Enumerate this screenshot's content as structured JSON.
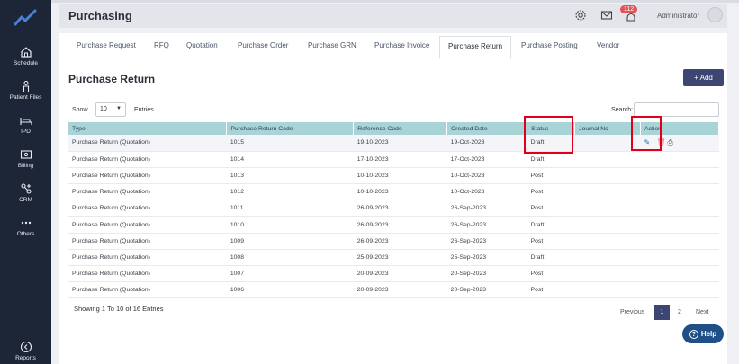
{
  "sidebar": {
    "items": [
      {
        "label": "Schedule",
        "icon": "home-icon"
      },
      {
        "label": "Patient Files",
        "icon": "person-icon"
      },
      {
        "label": "IPD",
        "icon": "bed-icon"
      },
      {
        "label": "Billing",
        "icon": "billing-icon"
      },
      {
        "label": "CRM",
        "icon": "crm-icon"
      },
      {
        "label": "Others",
        "icon": "more-icon"
      },
      {
        "label": "Reports",
        "icon": "reports-icon"
      }
    ]
  },
  "header": {
    "title": "Purchasing",
    "notification_count": "112",
    "user": "Administrator"
  },
  "tabs": [
    "Purchase Request",
    "RFQ",
    "Quotation",
    "Purchase Order",
    "Purchase GRN",
    "Purchase Invoice",
    "Purchase Return",
    "Purchase Posting",
    "Vendor"
  ],
  "active_tab": "Purchase Return",
  "page": {
    "title": "Purchase Return",
    "add_label": "+ Add"
  },
  "controls": {
    "show_label": "Show",
    "entries_value": "10",
    "entries_label": "Entries",
    "search_label": "Search:"
  },
  "table": {
    "columns": [
      "Type",
      "Purchase Return Code",
      "Reference Code",
      "Created Date",
      "Status",
      "Journal No",
      "Action"
    ],
    "rows": [
      {
        "type": "Purchase Return (Quotation)",
        "code": "1015",
        "ref": "19-10-2023",
        "created": "19-Oct-2023",
        "status": "Draft",
        "journal": ""
      },
      {
        "type": "Purchase Return (Quotation)",
        "code": "1014",
        "ref": "17-10-2023",
        "created": "17-Oct-2023",
        "status": "Draft",
        "journal": ""
      },
      {
        "type": "Purchase Return (Quotation)",
        "code": "1013",
        "ref": "10-10-2023",
        "created": "10-Oct-2023",
        "status": "Post",
        "journal": ""
      },
      {
        "type": "Purchase Return (Quotation)",
        "code": "1012",
        "ref": "10-10-2023",
        "created": "10-Oct-2023",
        "status": "Post",
        "journal": ""
      },
      {
        "type": "Purchase Return (Quotation)",
        "code": "1011",
        "ref": "26-09-2023",
        "created": "26-Sep-2023",
        "status": "Post",
        "journal": ""
      },
      {
        "type": "Purchase Return (Quotation)",
        "code": "1010",
        "ref": "26-09-2023",
        "created": "26-Sep-2023",
        "status": "Draft",
        "journal": ""
      },
      {
        "type": "Purchase Return (Quotation)",
        "code": "1009",
        "ref": "26-09-2023",
        "created": "26-Sep-2023",
        "status": "Post",
        "journal": ""
      },
      {
        "type": "Purchase Return (Quotation)",
        "code": "1008",
        "ref": "25-09-2023",
        "created": "25-Sep-2023",
        "status": "Draft",
        "journal": ""
      },
      {
        "type": "Purchase Return (Quotation)",
        "code": "1007",
        "ref": "20-09-2023",
        "created": "20-Sep-2023",
        "status": "Post",
        "journal": ""
      },
      {
        "type": "Purchase Return (Quotation)",
        "code": "1006",
        "ref": "20-09-2023",
        "created": "20-Sep-2023",
        "status": "Post",
        "journal": ""
      }
    ]
  },
  "footer": {
    "summary": "Showing 1 To 10 of 16 Entries",
    "previous": "Previous",
    "pages": [
      "1",
      "2"
    ],
    "next": "Next"
  },
  "help_label": "Help",
  "colors": {
    "sidebar_bg": "#1d2637",
    "table_header": "#a8d4d8",
    "accent": "#3d4673",
    "highlight_box": "#e0001b"
  }
}
